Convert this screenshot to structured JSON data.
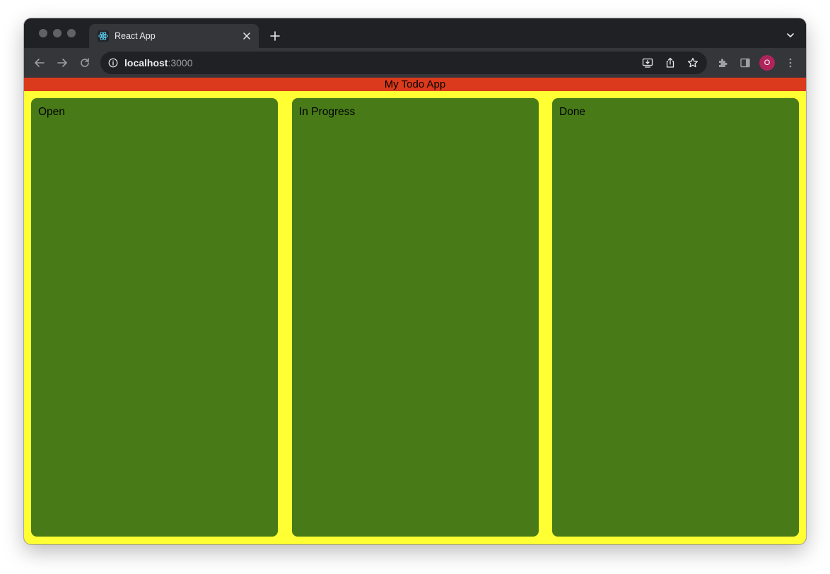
{
  "browser": {
    "tab": {
      "title": "React App",
      "favicon_icon": "react-logo-icon",
      "close_icon": "close-icon"
    },
    "new_tab_icon": "plus-icon",
    "tab_list_icon": "chevron-down-icon",
    "toolbar": {
      "back_icon": "arrow-left-icon",
      "forward_icon": "arrow-right-icon",
      "reload_icon": "reload-icon",
      "site_info_icon": "info-icon",
      "url_host": "localhost",
      "url_port": ":3000",
      "install_icon": "install-app-icon",
      "share_icon": "share-icon",
      "bookmark_icon": "star-icon",
      "extensions_icon": "puzzle-icon",
      "side_panel_icon": "side-panel-icon",
      "profile_initial": "O",
      "menu_icon": "kebab-menu-icon"
    },
    "colors": {
      "frame": "#202124",
      "toolbar": "#35363a",
      "profile": "#b0245c"
    }
  },
  "app": {
    "header": "My Todo App",
    "colors": {
      "background": "#ffff33",
      "header": "#dc3a1c",
      "column": "#487b18"
    },
    "columns": [
      {
        "title": "Open"
      },
      {
        "title": "In Progress"
      },
      {
        "title": "Done"
      }
    ]
  }
}
